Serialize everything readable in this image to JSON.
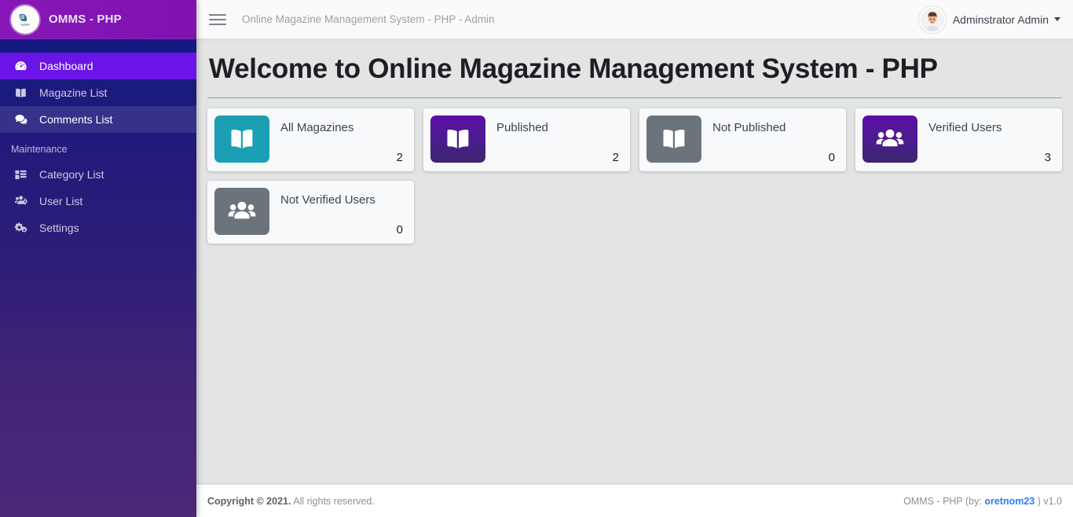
{
  "brand": {
    "title": "OMMS - PHP",
    "logo_icon": "book-circle-logo"
  },
  "sidebar": {
    "items": [
      {
        "label": "Dashboard",
        "icon": "dashboard-gauge-icon",
        "state": "active"
      },
      {
        "label": "Magazine List",
        "icon": "open-book-icon",
        "state": "normal"
      },
      {
        "label": "Comments List",
        "icon": "comments-icon",
        "state": "hovered"
      }
    ],
    "section_header": "Maintenance",
    "maintenance_items": [
      {
        "label": "Category List",
        "icon": "table-list-icon",
        "state": "normal"
      },
      {
        "label": "User List",
        "icon": "users-cog-icon",
        "state": "normal"
      },
      {
        "label": "Settings",
        "icon": "gears-icon",
        "state": "normal"
      }
    ],
    "gradient_top": "#0d1283",
    "gradient_bottom": "#4b2878",
    "active_color": "#6a14e8",
    "brand_bg": "#8717b8"
  },
  "topbar": {
    "menu_icon": "hamburger-icon",
    "title": "Online Magazine Management System - PHP - Admin",
    "user_name": "Adminstrator Admin",
    "avatar_icon": "user-avatar",
    "caret_icon": "caret-down-icon"
  },
  "page": {
    "heading": "Welcome to Online Magazine Management System - PHP",
    "rule_color": "#5bb8c4"
  },
  "cards": [
    {
      "label": "All Magazines",
      "value": "2",
      "icon": "open-book-icon",
      "color_class": "teal",
      "color": "#1b9fb4"
    },
    {
      "label": "Published",
      "value": "2",
      "icon": "open-book-icon",
      "color_class": "purple",
      "color": "#5b0ea8"
    },
    {
      "label": "Not Published",
      "value": "0",
      "icon": "open-book-icon",
      "color_class": "gray",
      "color": "#6b737c"
    },
    {
      "label": "Verified Users",
      "value": "3",
      "icon": "users-group-icon",
      "color_class": "purple",
      "color": "#5b0ea8"
    },
    {
      "label": "Not Verified Users",
      "value": "0",
      "icon": "users-group-icon",
      "color_class": "gray",
      "color": "#6b737c"
    }
  ],
  "footer": {
    "copyright_strong": "Copyright © 2021.",
    "copyright_rest": " All rights reserved.",
    "right_prefix": "OMMS - PHP (by: ",
    "right_author": "oretnom23",
    "right_suffix": " ) v1.0"
  }
}
